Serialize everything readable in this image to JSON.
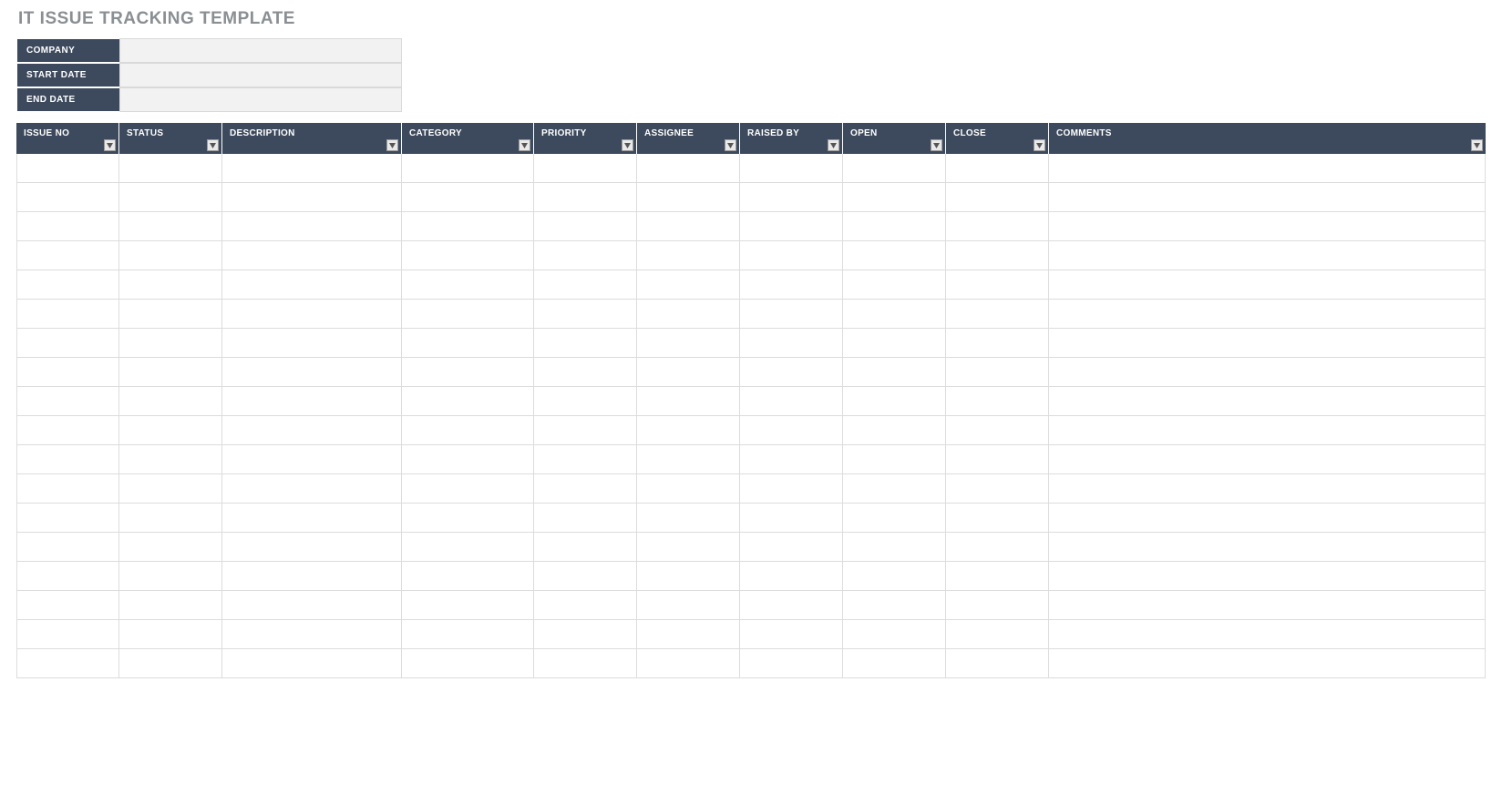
{
  "title": "IT ISSUE TRACKING TEMPLATE",
  "meta": {
    "company_label": "COMPANY",
    "company_value": "",
    "start_label": "START DATE",
    "start_value": "",
    "end_label": "END DATE",
    "end_value": ""
  },
  "columns": [
    {
      "key": "issue_no",
      "label": "ISSUE NO",
      "class": "c-issue"
    },
    {
      "key": "status",
      "label": "STATUS",
      "class": "c-status"
    },
    {
      "key": "description",
      "label": "DESCRIPTION",
      "class": "c-desc"
    },
    {
      "key": "category",
      "label": "CATEGORY",
      "class": "c-cat"
    },
    {
      "key": "priority",
      "label": "PRIORITY",
      "class": "c-prio"
    },
    {
      "key": "assignee",
      "label": "ASSIGNEE",
      "class": "c-assignee"
    },
    {
      "key": "raised_by",
      "label": "RAISED BY",
      "class": "c-raised"
    },
    {
      "key": "open",
      "label": "OPEN",
      "class": "c-open"
    },
    {
      "key": "close",
      "label": "CLOSE",
      "class": "c-close"
    },
    {
      "key": "comments",
      "label": "COMMENTS",
      "class": "c-comments"
    }
  ],
  "row_count": 18,
  "colors": {
    "header_bg": "#3d4a5d",
    "meta_value_bg": "#f2f2f2",
    "grid_line": "#dcdcdc",
    "title_color": "#8a8f93"
  }
}
